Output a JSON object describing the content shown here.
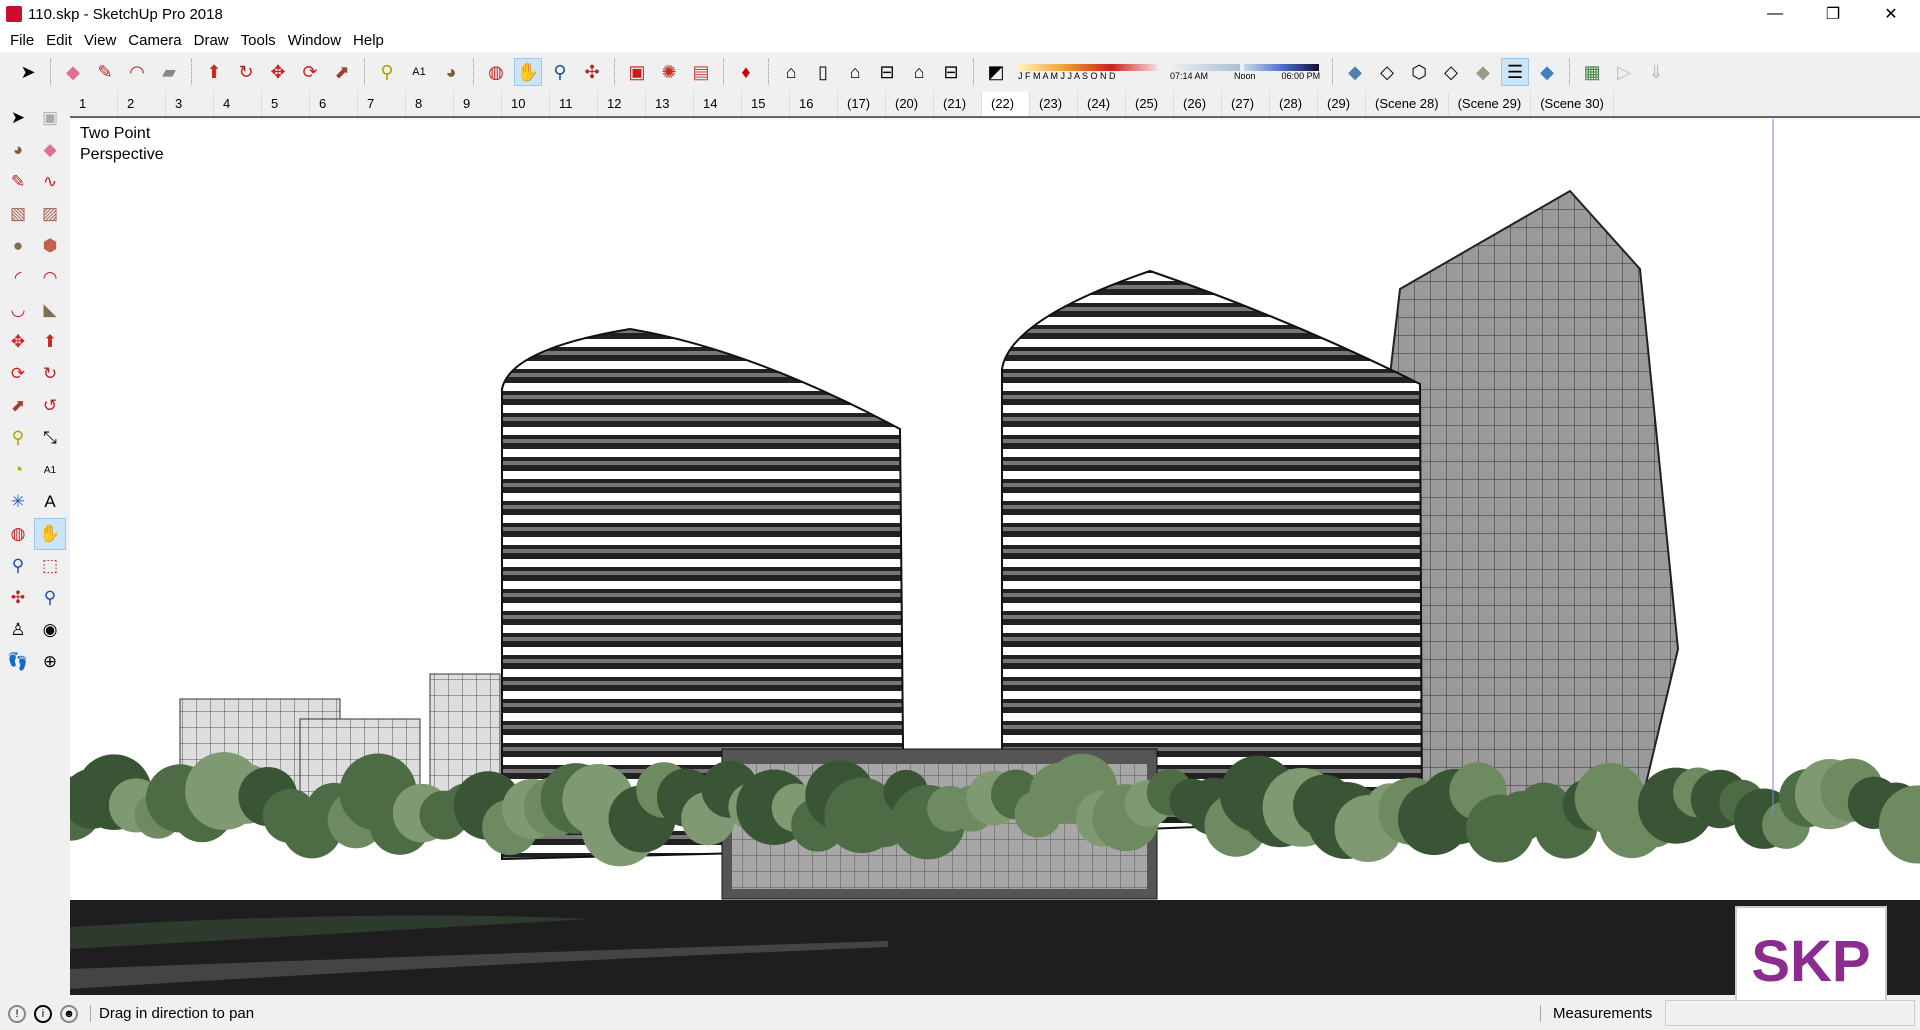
{
  "window": {
    "title": "110.skp - SketchUp Pro 2018",
    "minimize": "—",
    "maximize": "❐",
    "close": "✕"
  },
  "menu": [
    "File",
    "Edit",
    "View",
    "Camera",
    "Draw",
    "Tools",
    "Window",
    "Help"
  ],
  "shadow": {
    "months": "J F M A M J J A S O N D",
    "time_start": "07:14 AM",
    "time_mid": "Noon",
    "time_end": "06:00 PM"
  },
  "scenes": [
    "1",
    "2",
    "3",
    "4",
    "5",
    "6",
    "7",
    "8",
    "9",
    "10",
    "11",
    "12",
    "13",
    "14",
    "15",
    "16",
    "(17)",
    "(20)",
    "(21)",
    "(22)",
    "(23)",
    "(24)",
    "(25)",
    "(26)",
    "(27)",
    "(28)",
    "(29)",
    "(Scene 28)",
    "(Scene 29)",
    "(Scene 30)"
  ],
  "active_scene": "(22)",
  "viewport": {
    "camera_line1": "Two Point",
    "camera_line2": "Perspective"
  },
  "status": {
    "hint": "Drag in direction to pan",
    "measurements_label": "Measurements",
    "measurements_value": ""
  },
  "watermark": "SKP",
  "colors": {
    "accent": "#cce4f7",
    "logo": "#8a2d8e"
  }
}
